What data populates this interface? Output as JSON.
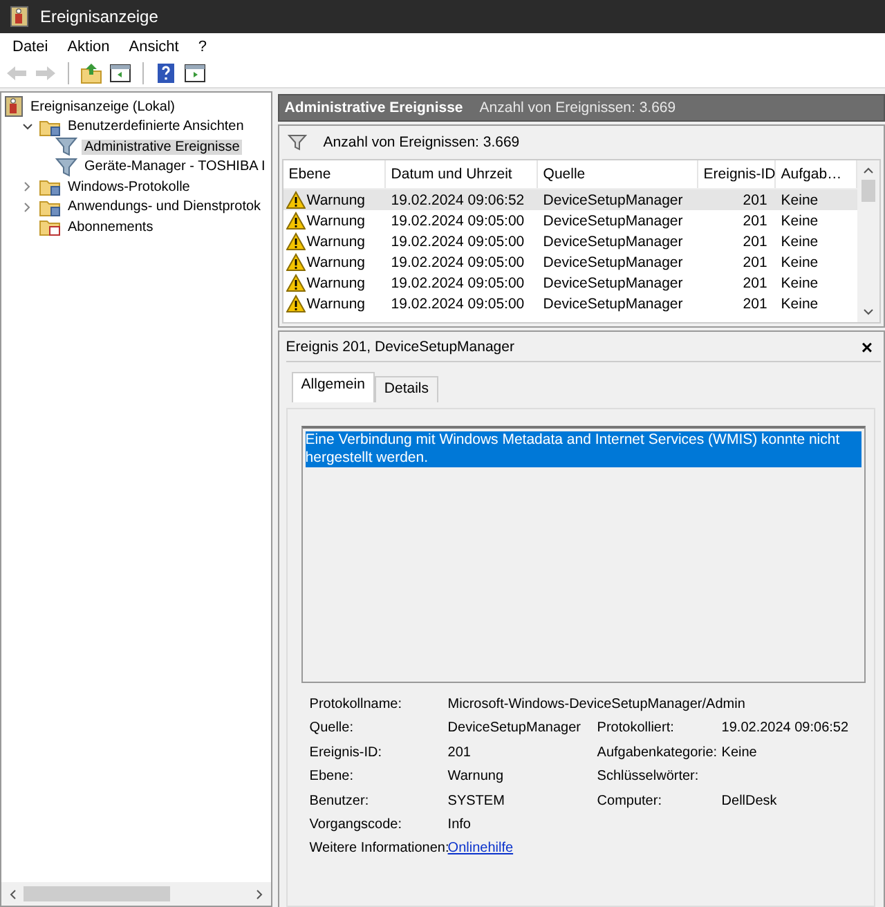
{
  "window": {
    "title": "Ereignisanzeige"
  },
  "menu": [
    "Datei",
    "Aktion",
    "Ansicht",
    "?"
  ],
  "toolbar": [
    {
      "kind": "back",
      "disabled": true
    },
    {
      "kind": "forward",
      "disabled": true
    },
    {
      "kind": "up-folder",
      "disabled": false
    },
    {
      "kind": "pane",
      "disabled": false
    },
    {
      "kind": "help",
      "disabled": false
    },
    {
      "kind": "action-pane",
      "disabled": false
    }
  ],
  "tree": [
    {
      "label": "Ereignisanzeige (Lokal)",
      "kind": "viewer",
      "selected": false,
      "children": [
        {
          "label": "Benutzerdefinierte Ansichten",
          "kind": "folder",
          "expanded": true,
          "selected": false,
          "children": [
            {
              "label": "Administrative Ereignisse",
              "kind": "filter",
              "selected": true
            },
            {
              "label": "Geräte-Manager - TOSHIBA I",
              "kind": "filter",
              "selected": false
            }
          ]
        },
        {
          "label": "Windows-Protokolle",
          "kind": "folder",
          "expanded": false,
          "selected": false
        },
        {
          "label": "Anwendungs- und Dienstprotok",
          "kind": "folder",
          "expanded": false,
          "selected": false
        },
        {
          "label": "Abonnements",
          "kind": "subscription",
          "selected": false
        }
      ]
    }
  ],
  "header": {
    "title": "Administrative Ereignisse",
    "count": "Anzahl von Ereignissen: 3.669"
  },
  "filter_bar": {
    "text": "Anzahl von Ereignissen: 3.669"
  },
  "table": {
    "columns": [
      "Ebene",
      "Datum und Uhrzeit",
      "Quelle",
      "Ereignis-ID",
      "Aufgab…"
    ],
    "rows": [
      {
        "kind": "warning",
        "selected": true,
        "cells": [
          "Warnung",
          "19.02.2024 09:06:52",
          "DeviceSetupManager",
          "201",
          "Keine"
        ]
      },
      {
        "kind": "warning",
        "selected": false,
        "cells": [
          "Warnung",
          "19.02.2024 09:05:00",
          "DeviceSetupManager",
          "201",
          "Keine"
        ]
      },
      {
        "kind": "warning",
        "selected": false,
        "cells": [
          "Warnung",
          "19.02.2024 09:05:00",
          "DeviceSetupManager",
          "201",
          "Keine"
        ]
      },
      {
        "kind": "warning",
        "selected": false,
        "cells": [
          "Warnung",
          "19.02.2024 09:05:00",
          "DeviceSetupManager",
          "201",
          "Keine"
        ]
      },
      {
        "kind": "warning",
        "selected": false,
        "cells": [
          "Warnung",
          "19.02.2024 09:05:00",
          "DeviceSetupManager",
          "201",
          "Keine"
        ]
      },
      {
        "kind": "warning",
        "selected": false,
        "cells": [
          "Warnung",
          "19.02.2024 09:05:00",
          "DeviceSetupManager",
          "201",
          "Keine"
        ]
      }
    ]
  },
  "detail": {
    "title": "Ereignis 201, DeviceSetupManager",
    "close": "×",
    "tabs": [
      {
        "label": "Allgemein",
        "selected": true
      },
      {
        "label": "Details",
        "selected": false
      }
    ],
    "description": {
      "text": "Eine Verbindung mit Windows Metadata and Internet Services (WMIS) konnte nicht hergestellt werden.",
      "highlighted": true
    },
    "properties": [
      {
        "label": "Protokollname:",
        "value": "Microsoft-Windows-DeviceSetupManager/Admin"
      },
      {
        "label": "Quelle:",
        "value": "DeviceSetupManager",
        "label2": "Protokolliert:",
        "value2": "19.02.2024 09:06:52"
      },
      {
        "label": "Ereignis-ID:",
        "value": "201",
        "label2": "Aufgabenkategorie:",
        "value2": "Keine"
      },
      {
        "label": "Ebene:",
        "value": "Warnung",
        "label2": "Schlüsselwörter:"
      },
      {
        "label": "Benutzer:",
        "value": "SYSTEM",
        "label2": "Computer:",
        "value2": "DellDesk"
      },
      {
        "label": "Vorgangscode:",
        "value": "Info"
      },
      {
        "label": "Weitere Informationen:",
        "value": "Onlinehilfe",
        "kind": "link"
      }
    ]
  }
}
